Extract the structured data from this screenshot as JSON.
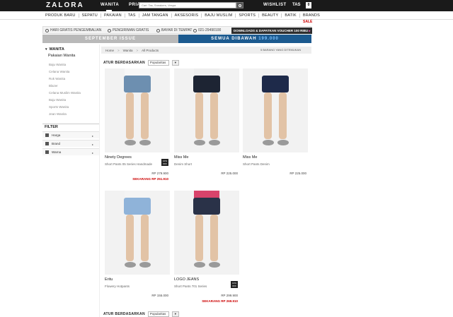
{
  "header": {
    "logo": "ZALORA",
    "gender_women": "WANITA",
    "gender_men": "PRIA",
    "search_placeholder": "Cari: Tas, Sneakers, Vespa",
    "wishlist": "WISHLIST",
    "bag": "TAS",
    "cart_count": "0"
  },
  "categories": [
    "PRODUK BARU",
    "SEPATU",
    "PAKAIAN",
    "TAS",
    "JAM TANGAN",
    "AKSESORIS",
    "BAJU MUSLIM",
    "SPORTS",
    "BEAUTY",
    "BATIK",
    "BRANDS"
  ],
  "sale_label": "SALE",
  "services": {
    "returns": "HARI GRATIS PENGEMBALIAN",
    "free_shipping": "PENGIRIMAN GRATIS",
    "cod": "BAYAR DI TEMPAT",
    "phone": "021-29490100",
    "voucher_text": "DOWNLOADS & DAPATKAN VOUCHER 100 RIBU",
    "voucher_code": "▸"
  },
  "promo": {
    "left": "SEPTEMBER ISSUE",
    "right_text": "SEMUA DIBAWAH",
    "right_code": "199.000"
  },
  "sidebar": {
    "section": "WANITA",
    "subsection": "Pakaian Wanita",
    "items": [
      "Baju Wanita",
      "Celana Wanita",
      "Rok Wanita",
      "Blazer",
      "Celana Muslim Wanita",
      "Baju Wanita",
      "Sports Wanita",
      "Jean Wanita"
    ],
    "filter_title": "FILTER",
    "filters": [
      "Harga",
      "Brand",
      "Warna"
    ]
  },
  "breadcrumb": [
    "Home",
    "Wanita",
    "All Products"
  ],
  "result_count": "5 BARANG YANG DITEMUKAN",
  "sort": {
    "label": "ATUR BERDASARKAN",
    "selected": "Popularitas",
    "arrow": "▼"
  },
  "products": [
    {
      "brand": "Ninety Degrees",
      "name": "Short Pants 05 Series Handmade",
      "price": "RP 279.900",
      "sale_price": "SEKARANG RP 251.910",
      "badge": "10% OFF",
      "shorts_color": "#6d8fb0",
      "top_color": "#f7f7f7"
    },
    {
      "brand": "Miss Me",
      "name": "Denim Short",
      "price": "RP 225.000",
      "sale_price": "",
      "badge": "",
      "shorts_color": "#1d2433",
      "top_color": "#eeeeee"
    },
    {
      "brand": "Miss Me",
      "name": "Short Pants Denim",
      "price": "RP 225.000",
      "sale_price": "",
      "badge": "",
      "shorts_color": "#1e2a4a",
      "top_color": "#f1f1f1"
    },
    {
      "brand": "Eritu",
      "name": "Flowery Hotpants",
      "price": "RP 155.000",
      "sale_price": "",
      "badge": "",
      "shorts_color": "#8fb3d9",
      "top_color": "#f4f4f4"
    },
    {
      "brand": "LOGO JEANS",
      "name": "Short Pants 701 Series",
      "price": "RP 299.900",
      "sale_price": "SEKARANG RP 269.910",
      "badge": "10% OFF",
      "shorts_color": "#2a3248",
      "top_color": "#d9436b"
    }
  ]
}
